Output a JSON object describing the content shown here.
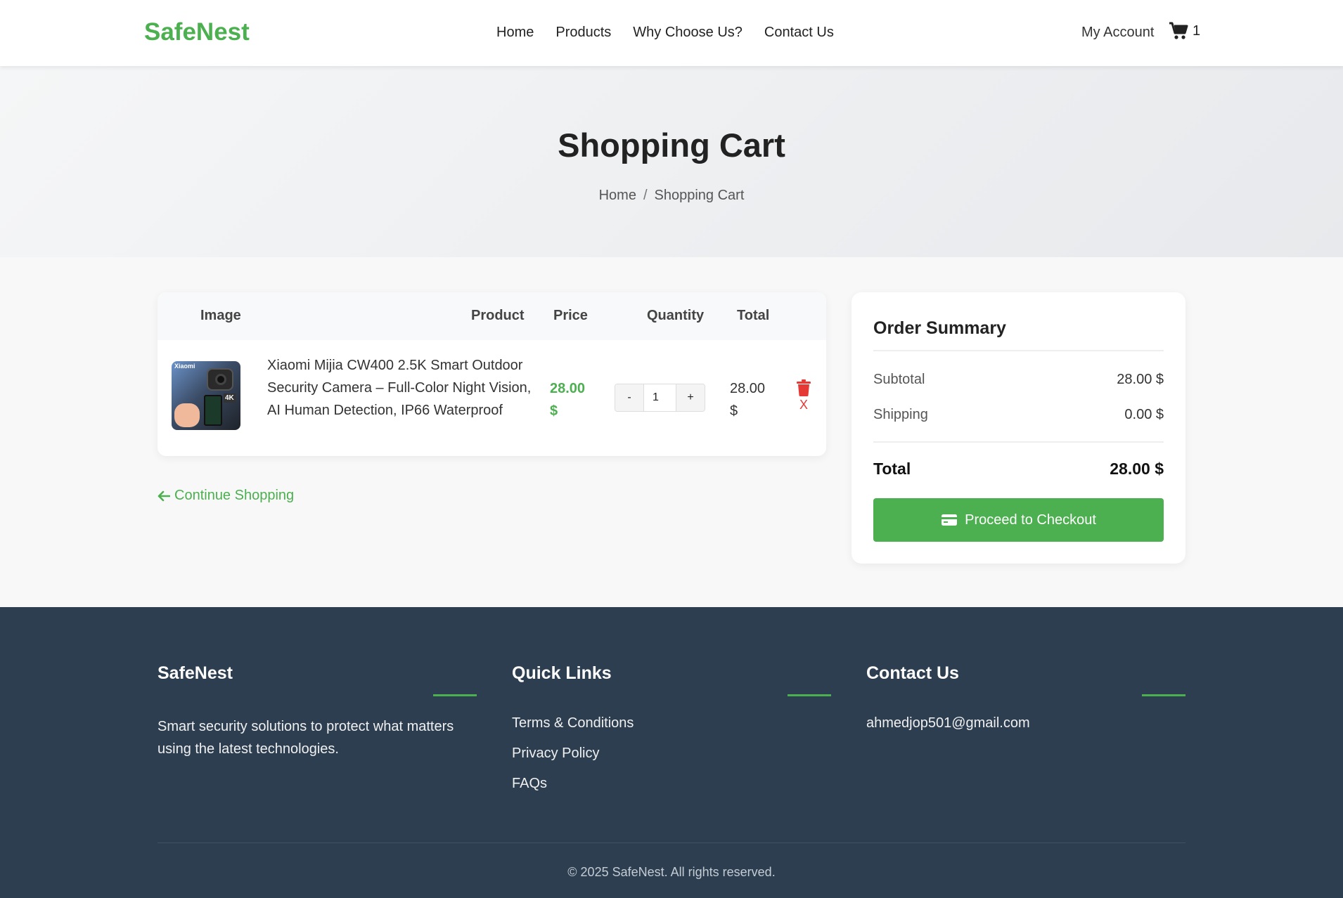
{
  "header": {
    "logo": "SafeNest",
    "nav": [
      "Home",
      "Products",
      "Why Choose Us?",
      "Contact Us"
    ],
    "account": "My Account",
    "cart_count": "1"
  },
  "hero": {
    "title": "Shopping Cart",
    "breadcrumb": [
      "Home",
      "/",
      "Shopping Cart"
    ]
  },
  "cart": {
    "columns": [
      "Image",
      "Product",
      "Price",
      "Quantity",
      "Total"
    ],
    "items": [
      {
        "image_text": [
          "Xiaomi",
          "4K"
        ],
        "name": "Xiaomi Mijia CW400 2.5K Smart Outdoor Security Camera – Full-Color Night Vision, AI Human Detection, IP66 Waterproof",
        "price": "28.00 $",
        "quantity": "1",
        "total": "28.00 $",
        "remove_label": "X"
      }
    ],
    "qty_minus": "-",
    "qty_plus": "+",
    "continue_label": "Continue Shopping"
  },
  "summary": {
    "title": "Order Summary",
    "subtotal_label": "Subtotal",
    "subtotal_value": "28.00 $",
    "shipping_label": "Shipping",
    "shipping_value": "0.00 $",
    "total_label": "Total",
    "total_value": "28.00 $",
    "checkout_label": "Proceed to Checkout"
  },
  "footer": {
    "about_title": "SafeNest",
    "about_text": "Smart security solutions to protect what matters using the latest technologies.",
    "links_title": "Quick Links",
    "links": [
      "Terms & Conditions",
      "Privacy Policy",
      "FAQs"
    ],
    "contact_title": "Contact Us",
    "email": "ahmedjop501@gmail.com",
    "copyright": "© 2025 SafeNest. All rights reserved."
  },
  "colors": {
    "brand": "#4caf50",
    "danger": "#e53935",
    "footer_bg": "#2c3e50"
  }
}
